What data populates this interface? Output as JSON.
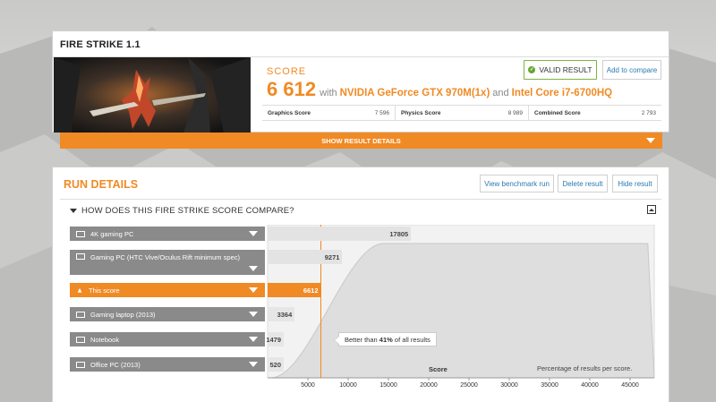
{
  "result_card": {
    "title": "FIRE STRIKE 1.1",
    "score_label": "SCORE",
    "score": "6 612",
    "with_text": "with",
    "gpu": "NVIDIA GeForce GTX 970M(1x)",
    "and_text": "and",
    "cpu": "Intel Core i7-6700HQ",
    "valid_label": "VALID RESULT",
    "compare_label": "Add to compare",
    "subscores": [
      {
        "label": "Graphics Score",
        "value": "7 596"
      },
      {
        "label": "Physics Score",
        "value": "8 989"
      },
      {
        "label": "Combined Score",
        "value": "2 793"
      }
    ],
    "show_details_label": "SHOW RESULT DETAILS"
  },
  "run_details": {
    "title": "RUN DETAILS",
    "buttons": {
      "view_benchmark": "View benchmark run",
      "delete": "Delete result",
      "hide": "Hide result"
    },
    "compare_title": "HOW DOES THIS FIRE STRIKE SCORE COMPARE?"
  },
  "colors": {
    "accent": "#f08a24",
    "valid": "#6aa531",
    "link": "#2a7ab0"
  },
  "chart_data": {
    "type": "bar",
    "categories": [
      "4K gaming PC",
      "Gaming PC (HTC Vive/Oculus Rift minimum spec)",
      "This score",
      "Gaming laptop (2013)",
      "Notebook",
      "Office PC (2013)"
    ],
    "values": [
      17805,
      9271,
      6612,
      3364,
      1479,
      520
    ],
    "value_labels": [
      "17805",
      "9271",
      "6612",
      "3364",
      "1479",
      "520"
    ],
    "highlight_index": 2,
    "xlabel": "Score",
    "ylabel": "Percentage of results per score.",
    "xticks": [
      5000,
      10000,
      15000,
      20000,
      25000,
      30000,
      35000,
      40000,
      45000
    ],
    "xtick_labels": [
      "5000",
      "10000",
      "15000",
      "20000",
      "25000",
      "30000",
      "35000",
      "40000",
      "45000"
    ],
    "xlim": [
      0,
      48000
    ],
    "tooltip": {
      "prefix": "Better than",
      "percent": "41%",
      "suffix": "of all results"
    }
  }
}
